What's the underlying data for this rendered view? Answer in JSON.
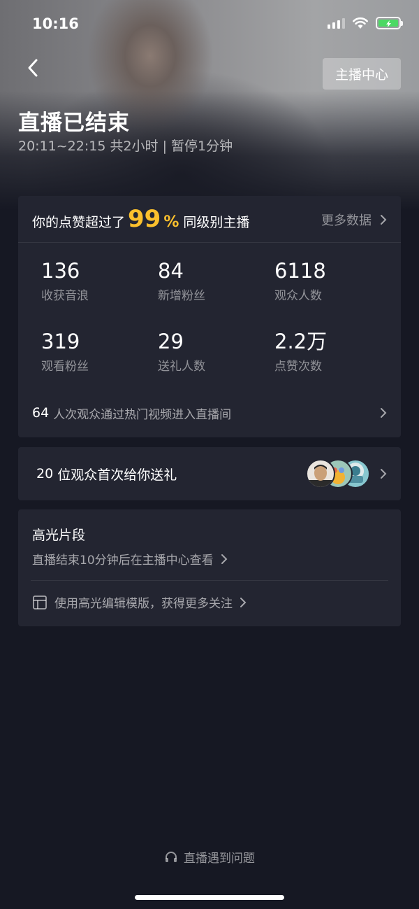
{
  "status_bar": {
    "time": "10:16"
  },
  "header": {
    "anchor_center_label": "主播中心",
    "title": "直播已结束",
    "subtitle": "20:11~22:15 共2小时 | 暂停1分钟"
  },
  "stats": {
    "lead_prefix": "你的点赞超过了",
    "percent": "99",
    "percent_sign": "%",
    "lead_suffix": "同级别主播",
    "more_data_label": "更多数据",
    "metrics": [
      {
        "value": "136",
        "label": "收获音浪"
      },
      {
        "value": "84",
        "label": "新增粉丝"
      },
      {
        "value": "6118",
        "label": "观众人数"
      },
      {
        "value": "319",
        "label": "观看粉丝"
      },
      {
        "value": "29",
        "label": "送礼人数"
      },
      {
        "value": "2.2万",
        "label": "点赞次数"
      }
    ],
    "hot_video_count": "64",
    "hot_video_text": "人次观众通过热门视频进入直播间"
  },
  "gift": {
    "count": "20",
    "text": "位观众首次给你送礼"
  },
  "highlights": {
    "title": "高光片段",
    "subtitle": "直播结束10分钟后在主播中心查看",
    "template_text": "使用高光编辑模版，获得更多关注"
  },
  "footer": {
    "problem_label": "直播遇到问题"
  },
  "colors": {
    "accent": "#fbc02d",
    "background": "#161823",
    "card": "#232531"
  }
}
